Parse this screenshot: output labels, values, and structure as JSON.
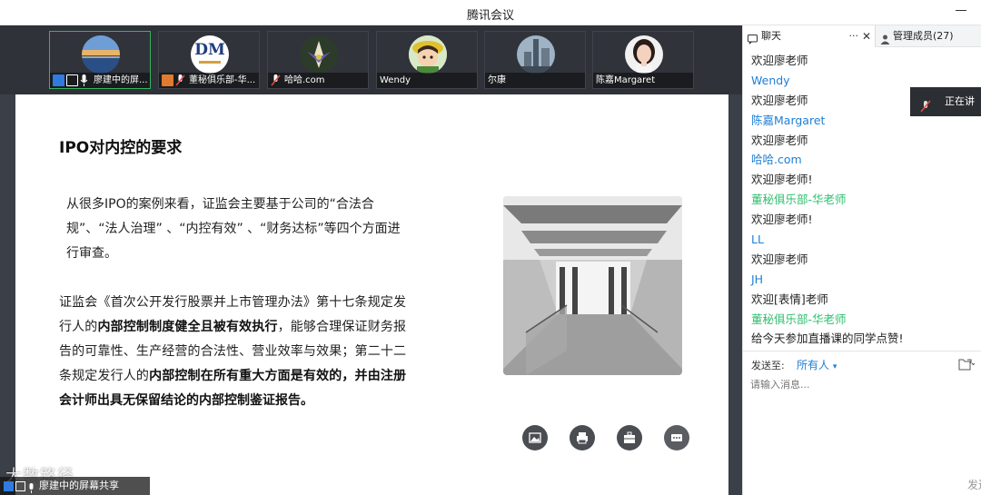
{
  "window": {
    "title": "腾讯会议"
  },
  "participants": [
    {
      "name": "廖建中的屏...",
      "avatar": "sunset-photo-avatar"
    },
    {
      "name": "董秘俱乐部-华...",
      "avatar": "dm-logo-avatar",
      "logo_text": "DM"
    },
    {
      "name": "哈哈.com",
      "avatar": "flower-photo-avatar"
    },
    {
      "name": "Wendy",
      "avatar": "cartoon-girl-avatar"
    },
    {
      "name": "尔康",
      "avatar": "skyscraper-photo-avatar"
    },
    {
      "name": "陈嘉Margaret",
      "avatar": "woman-portrait-avatar"
    }
  ],
  "slide": {
    "title": "IPO对内控的要求",
    "para1": "从很多IPO的案例来看，证监会主要基于公司的“合法合规”、“法人治理” 、“内控有效” 、“财务达标”等四个方面进行审查。",
    "para2": {
      "t1": "证监会《首次公开发行股票并上市管理办法》第十七条规定发行人的",
      "b1": "内部控制制度健全且被有效执行",
      "t2": "，能够合理保证财务报告的可靠性、生产经营的合法性、营业效率与效果；第二十二条规定发行人的",
      "b2": "内部控制在所有重大方面是有效的，并由注册会计师出具无保留结论的内部控制鉴证报告。"
    },
    "action_icons": [
      "image-icon",
      "print-icon",
      "briefcase-icon",
      "more-dots-icon"
    ]
  },
  "screen_share": {
    "label": "廖建中的屏幕共享",
    "watermark": "大数路径"
  },
  "chat": {
    "tab_chat": "聊天",
    "tab_more": "···",
    "tab_close": "✕",
    "tab_members": "管理成员(27)",
    "messages": [
      {
        "kind": "text",
        "text": "欢迎廖老师"
      },
      {
        "kind": "sender",
        "text": "Wendy"
      },
      {
        "kind": "text",
        "text": "欢迎廖老师"
      },
      {
        "kind": "sender",
        "text": "陈嘉Margaret"
      },
      {
        "kind": "text",
        "text": "欢迎廖老师"
      },
      {
        "kind": "sender",
        "text": "哈哈.com"
      },
      {
        "kind": "text",
        "text": "欢迎廖老师!"
      },
      {
        "kind": "host",
        "text": "董秘俱乐部-华老师"
      },
      {
        "kind": "text",
        "text": "欢迎廖老师!"
      },
      {
        "kind": "sender",
        "text": "LL"
      },
      {
        "kind": "text",
        "text": "欢迎廖老师"
      },
      {
        "kind": "sender",
        "text": "JH"
      },
      {
        "kind": "text",
        "text": "欢迎[表情]老师"
      },
      {
        "kind": "host",
        "text": "董秘俱乐部-华老师"
      },
      {
        "kind": "text",
        "text": "给今天参加直播课的同学点赞!"
      }
    ],
    "speaking_label": "正在讲话",
    "send_to_label": "发送至:",
    "send_target": "所有人",
    "input_placeholder": "请输入消息...",
    "send_button": "发送"
  },
  "colors": {
    "sender": "#1e7fd6",
    "host": "#2fbd6d",
    "strip_bg": "#2f3238",
    "active_border": "#36b35f"
  }
}
